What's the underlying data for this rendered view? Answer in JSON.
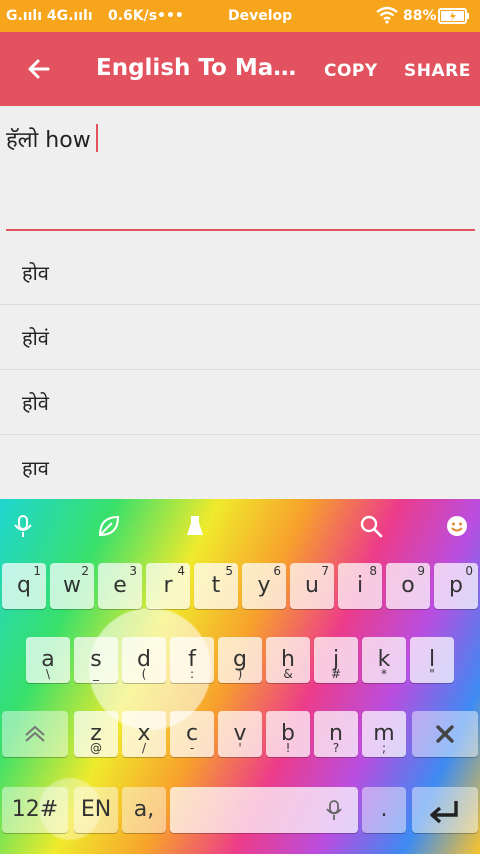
{
  "status_bar": {
    "signal": "G.ıılı 4G.ıılı",
    "speed": "0.6K/s",
    "dots": "•••",
    "center": "Develop",
    "battery": "88%",
    "bg_color": "#f7a51d"
  },
  "app_bar": {
    "back_icon": "arrow-left-icon",
    "title": "English To Mar...",
    "copy_label": "COPY",
    "share_label": "SHARE",
    "color": "#e2525f"
  },
  "editor": {
    "text": "हॅलो how"
  },
  "suggestions": [
    "होव",
    "होवं",
    "होवे",
    "हाव"
  ],
  "keyboard": {
    "toolbar_icons": [
      "microphone-icon",
      "leaf-icon",
      "theme-icon",
      "search-icon",
      "emoji-icon"
    ],
    "row1": [
      {
        "main": "q",
        "sub": "1"
      },
      {
        "main": "w",
        "sub": "2"
      },
      {
        "main": "e",
        "sub": "3"
      },
      {
        "main": "r",
        "sub": "4"
      },
      {
        "main": "t",
        "sub": "5"
      },
      {
        "main": "y",
        "sub": "6"
      },
      {
        "main": "u",
        "sub": "7"
      },
      {
        "main": "i",
        "sub": "8"
      },
      {
        "main": "o",
        "sub": "9"
      },
      {
        "main": "p",
        "sub": "0"
      }
    ],
    "row2": [
      {
        "main": "a",
        "hint": "\\"
      },
      {
        "main": "s",
        "hint": "_"
      },
      {
        "main": "d",
        "hint": "("
      },
      {
        "main": "f",
        "hint": ":"
      },
      {
        "main": "g",
        "hint": ")"
      },
      {
        "main": "h",
        "hint": "&"
      },
      {
        "main": "j",
        "hint": "#"
      },
      {
        "main": "k",
        "hint": "*"
      },
      {
        "main": "l",
        "hint": "\""
      }
    ],
    "row3": [
      {
        "main": "z",
        "hint": "@"
      },
      {
        "main": "x",
        "hint": "/"
      },
      {
        "main": "c",
        "hint": "-"
      },
      {
        "main": "v",
        "hint": "'"
      },
      {
        "main": "b",
        "hint": "!"
      },
      {
        "main": "n",
        "hint": "?"
      },
      {
        "main": "m",
        "hint": ";"
      }
    ],
    "shift_icon": "shift-icon",
    "delete_icon": "backspace-x-icon",
    "symbols_label": "12#",
    "lang_label": "EN",
    "comma_label": "a,",
    "space_mic_icon": "microphone-icon",
    "period_label": ".",
    "enter_icon": "enter-icon"
  }
}
